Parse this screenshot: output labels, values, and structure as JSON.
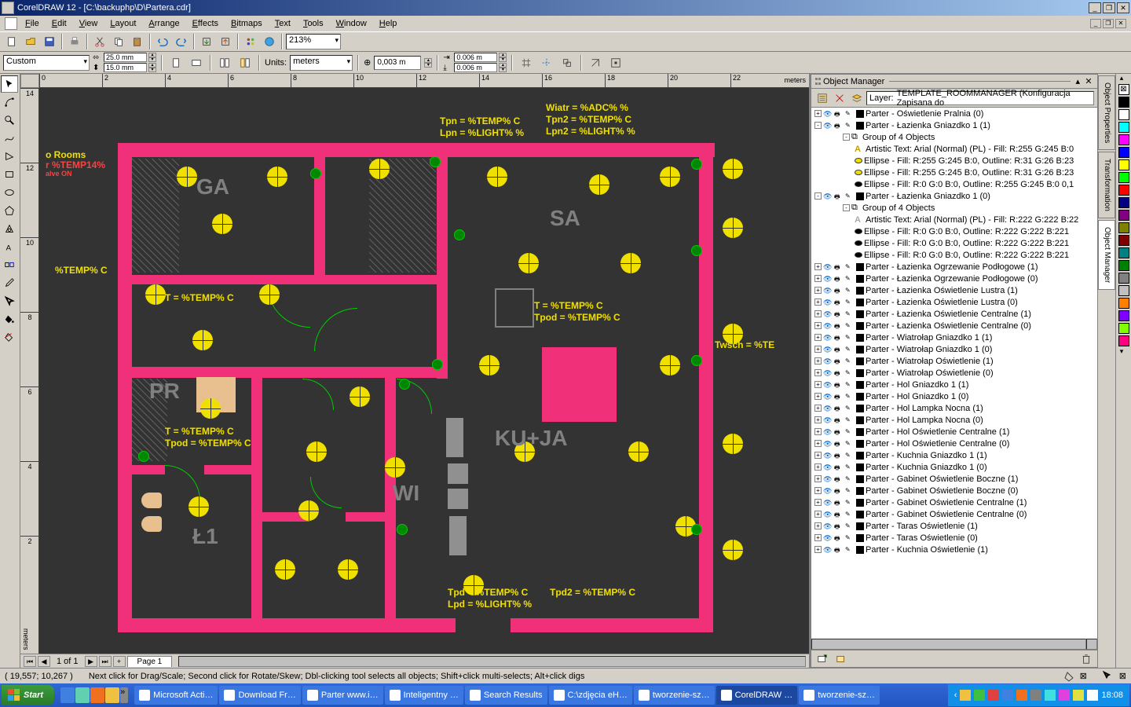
{
  "title": "CorelDRAW 12 - [C:\\backuphp\\D\\Partera.cdr]",
  "menus": [
    "File",
    "Edit",
    "View",
    "Layout",
    "Arrange",
    "Effects",
    "Bitmaps",
    "Text",
    "Tools",
    "Window",
    "Help"
  ],
  "zoom": "213%",
  "optbar": {
    "paper": "Custom",
    "pw": "25.0 mm",
    "ph": "15.0 mm",
    "units_label": "Units:",
    "units": "meters",
    "nudge": "0,003 m",
    "dup_x": "0.006 m",
    "dup_y": "0.006 m"
  },
  "hruler_unit": "meters",
  "vruler_unit": "meters",
  "hruler_ticks": [
    "0",
    "2",
    "4",
    "6",
    "8",
    "10",
    "12",
    "14",
    "16",
    "18",
    "20",
    "22"
  ],
  "vruler_ticks": [
    "14",
    "12",
    "10",
    "8",
    "6",
    "4",
    "2"
  ],
  "rooms": {
    "ga": "GA",
    "sa": "SA",
    "pr": "PR",
    "ku": "KU+JA",
    "wi": "WI",
    "l1": "Ł1"
  },
  "yl": {
    "temp": "%TEMP% C",
    "temp14": "r %TEMP14%",
    "rooms": "o Rooms",
    "relay": "alve ON",
    "t": "T = %TEMP% C",
    "tpod": "Tpod = %TEMP% C",
    "tpn": "Tpn = %TEMP% C",
    "lpn": "Lpn = %LIGHT% %",
    "wiatr": "Wiatr = %ADC% %",
    "tpn2": "Tpn2 = %TEMP% C",
    "lpn2": "Lpn2 = %LIGHT% %",
    "twsch": "Twsch = %TE",
    "tpd": "Tpd = %TEMP% C",
    "tpd2": "Tpd2 = %TEMP% C",
    "lpd": "Lpd = %LIGHT% %"
  },
  "page": {
    "cur": "1 of 1",
    "tab": "Page 1"
  },
  "status": {
    "coord": "( 19,557; 10,267 )",
    "hint": "Next click for Drag/Scale; Second click for Rotate/Skew; Dbl-clicking tool selects all objects; Shift+click multi-selects; Alt+click digs"
  },
  "docker": {
    "title": "Object Manager",
    "layer_prefix": "Layer:",
    "layer": "TEMPLATE_ROOMMANAGER (Konfiguracja Zapisana do",
    "items": [
      {
        "lvl": 0,
        "exp": "+",
        "color": "#000",
        "txt": "Parter - Oświetlenie Pralnia (0)"
      },
      {
        "lvl": 0,
        "exp": "-",
        "color": "#000",
        "txt": "Parter - Łazienka Gniazdko 1 (1)"
      },
      {
        "lvl": 1,
        "exp": "-",
        "txt": "Group of 4 Objects",
        "icon": "group"
      },
      {
        "lvl": 2,
        "txt": "Artistic Text: Arial (Normal) (PL) - Fill: R:255 G:245 B:0",
        "icon": "text-y"
      },
      {
        "lvl": 2,
        "txt": "Ellipse - Fill: R:255 G:245 B:0, Outline: R:31 G:26 B:23",
        "icon": "ell-y"
      },
      {
        "lvl": 2,
        "txt": "Ellipse - Fill: R:255 G:245 B:0, Outline: R:31 G:26 B:23",
        "icon": "ell-y"
      },
      {
        "lvl": 2,
        "txt": "Ellipse - Fill: R:0 G:0 B:0, Outline: R:255 G:245 B:0  0,1",
        "icon": "ell-k"
      },
      {
        "lvl": 0,
        "exp": "-",
        "color": "#000",
        "txt": "Parter - Łazienka Gniazdko 1 (0)"
      },
      {
        "lvl": 1,
        "exp": "-",
        "txt": "Group of 4 Objects",
        "icon": "group"
      },
      {
        "lvl": 2,
        "txt": "Artistic Text: Arial (Normal) (PL) - Fill: R:222 G:222 B:22",
        "icon": "text-g"
      },
      {
        "lvl": 2,
        "txt": "Ellipse - Fill: R:0 G:0 B:0, Outline: R:222 G:222 B:221",
        "icon": "ell-k"
      },
      {
        "lvl": 2,
        "txt": "Ellipse - Fill: R:0 G:0 B:0, Outline: R:222 G:222 B:221",
        "icon": "ell-k"
      },
      {
        "lvl": 2,
        "txt": "Ellipse - Fill: R:0 G:0 B:0, Outline: R:222 G:222 B:221",
        "icon": "ell-k"
      },
      {
        "lvl": 0,
        "exp": "+",
        "color": "#000",
        "txt": "Parter - Łazienka Ogrzewanie Podłogowe (1)"
      },
      {
        "lvl": 0,
        "exp": "+",
        "color": "#000",
        "txt": "Parter - Łazienka Ogrzewanie Podłogowe (0)"
      },
      {
        "lvl": 0,
        "exp": "+",
        "color": "#000",
        "txt": "Parter - Łazienka Oświetlenie Lustra (1)"
      },
      {
        "lvl": 0,
        "exp": "+",
        "color": "#000",
        "txt": "Parter - Łazienka Oświetlenie Lustra (0)"
      },
      {
        "lvl": 0,
        "exp": "+",
        "color": "#000",
        "txt": "Parter - Łazienka Oświetlenie Centralne (1)"
      },
      {
        "lvl": 0,
        "exp": "+",
        "color": "#000",
        "txt": "Parter - Łazienka Oświetlenie Centralne (0)"
      },
      {
        "lvl": 0,
        "exp": "+",
        "color": "#000",
        "txt": "Parter - Wiatrołap Gniazdko 1 (1)"
      },
      {
        "lvl": 0,
        "exp": "+",
        "color": "#000",
        "txt": "Parter - Wiatrołap Gniazdko 1 (0)"
      },
      {
        "lvl": 0,
        "exp": "+",
        "color": "#000",
        "txt": "Parter - Wiatrołap Oświetlenie (1)"
      },
      {
        "lvl": 0,
        "exp": "+",
        "color": "#000",
        "txt": "Parter - Wiatrołap Oświetlenie (0)"
      },
      {
        "lvl": 0,
        "exp": "+",
        "color": "#000",
        "txt": "Parter - Hol Gniazdko 1 (1)"
      },
      {
        "lvl": 0,
        "exp": "+",
        "color": "#000",
        "txt": "Parter - Hol Gniazdko 1 (0)"
      },
      {
        "lvl": 0,
        "exp": "+",
        "color": "#000",
        "txt": "Parter - Hol Lampka Nocna (1)"
      },
      {
        "lvl": 0,
        "exp": "+",
        "color": "#000",
        "txt": "Parter - Hol Lampka Nocna (0)"
      },
      {
        "lvl": 0,
        "exp": "+",
        "color": "#000",
        "txt": "Parter - Hol Oświetlenie Centralne (1)"
      },
      {
        "lvl": 0,
        "exp": "+",
        "color": "#000",
        "txt": "Parter - Hol Oświetlenie Centralne (0)"
      },
      {
        "lvl": 0,
        "exp": "+",
        "color": "#000",
        "txt": "Parter - Kuchnia Gniazdko 1 (1)"
      },
      {
        "lvl": 0,
        "exp": "+",
        "color": "#000",
        "txt": "Parter - Kuchnia Gniazdko 1 (0)"
      },
      {
        "lvl": 0,
        "exp": "+",
        "color": "#000",
        "txt": "Parter - Gabinet Oświetlenie Boczne (1)"
      },
      {
        "lvl": 0,
        "exp": "+",
        "color": "#000",
        "txt": "Parter - Gabinet Oświetlenie Boczne (0)"
      },
      {
        "lvl": 0,
        "exp": "+",
        "color": "#000",
        "txt": "Parter - Gabinet Oświetlenie Centralne (1)"
      },
      {
        "lvl": 0,
        "exp": "+",
        "color": "#000",
        "txt": "Parter - Gabinet Oświetlenie Centralne (0)"
      },
      {
        "lvl": 0,
        "exp": "+",
        "color": "#000",
        "txt": "Parter - Taras Oświetlenie (1)"
      },
      {
        "lvl": 0,
        "exp": "+",
        "color": "#000",
        "txt": "Parter - Taras Oświetlenie (0)"
      },
      {
        "lvl": 0,
        "exp": "+",
        "color": "#000",
        "txt": "Parter - Kuchnia Oświetlenie (1)"
      }
    ]
  },
  "side_tabs": [
    "Object Properties",
    "Transformation",
    "Object Manager"
  ],
  "palette": [
    "none",
    "#000000",
    "#ffffff",
    "#00ffff",
    "#ff00ff",
    "#0000ff",
    "#ffff00",
    "#00ff00",
    "#ff0000",
    "#000080",
    "#800080",
    "#808000",
    "#800000",
    "#008080",
    "#008000",
    "#808080",
    "#c0c0c0",
    "#ff8000",
    "#8000ff",
    "#80ff00",
    "#ff0080"
  ],
  "taskbar": {
    "start": "Start",
    "tasks": [
      {
        "txt": "Microsoft Acti…",
        "active": false
      },
      {
        "txt": "Download Fr…",
        "active": false
      },
      {
        "txt": "Parter www.i…",
        "active": false
      },
      {
        "txt": "Inteligentny …",
        "active": false
      },
      {
        "txt": "Search Results",
        "active": false
      },
      {
        "txt": "C:\\zdjęcia eH…",
        "active": false
      },
      {
        "txt": "tworzenie-sz…",
        "active": false
      },
      {
        "txt": "CorelDRAW …",
        "active": true
      },
      {
        "txt": "tworzenie-sz…",
        "active": false
      }
    ],
    "time": "18:08"
  }
}
